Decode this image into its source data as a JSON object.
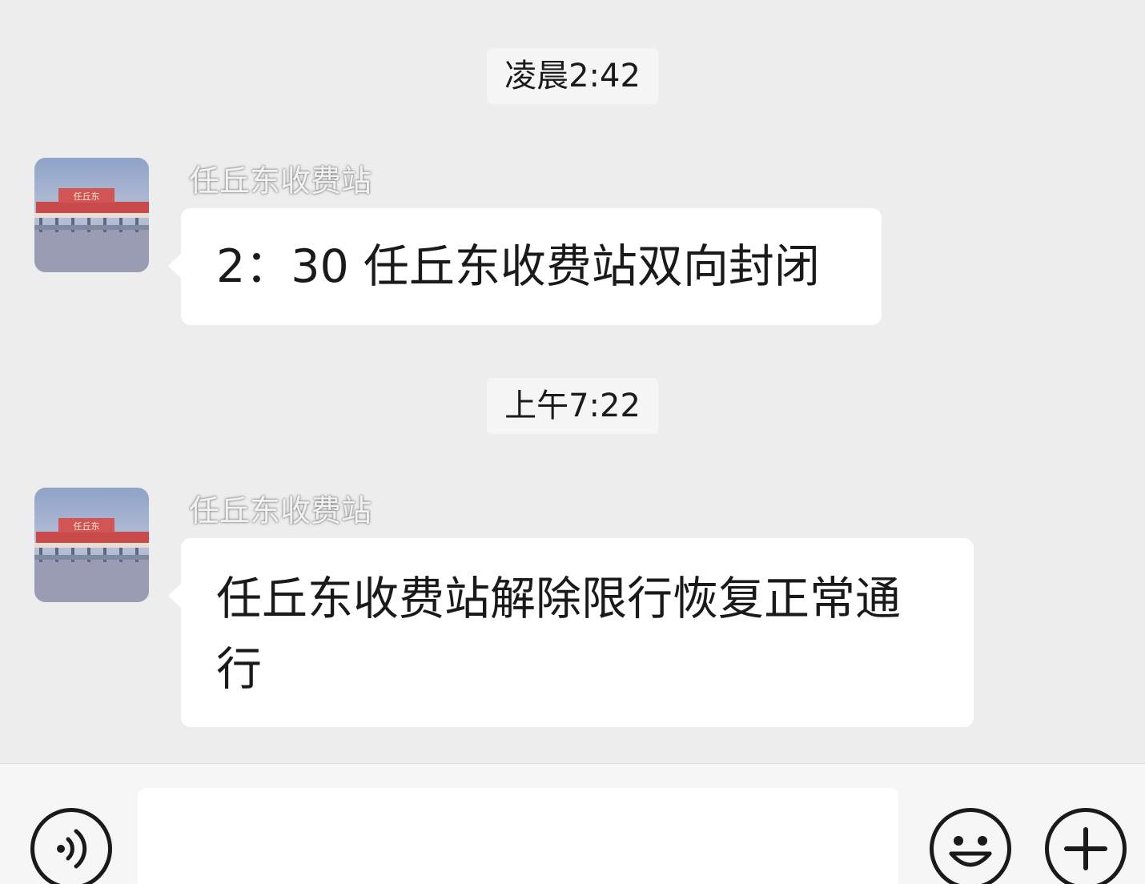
{
  "messages": [
    {
      "timestamp": "凌晨2:42",
      "sender": "任丘东收费站",
      "avatar_icon": "toll-station-photo-avatar",
      "text": "2：30 任丘东收费站双向封闭"
    },
    {
      "timestamp": "上午7:22",
      "sender": "任丘东收费站",
      "avatar_icon": "toll-station-photo-avatar",
      "text": "任丘东收费站解除限行恢复正常通行"
    }
  ],
  "input_bar": {
    "voice_icon": "voice-icon",
    "text_value": "",
    "emoji_icon": "emoji-icon",
    "plus_icon": "plus-icon"
  },
  "colors": {
    "background": "#ededed",
    "bubble": "#ffffff",
    "text": "#1a1a1a",
    "input_bar": "#f6f6f6"
  }
}
